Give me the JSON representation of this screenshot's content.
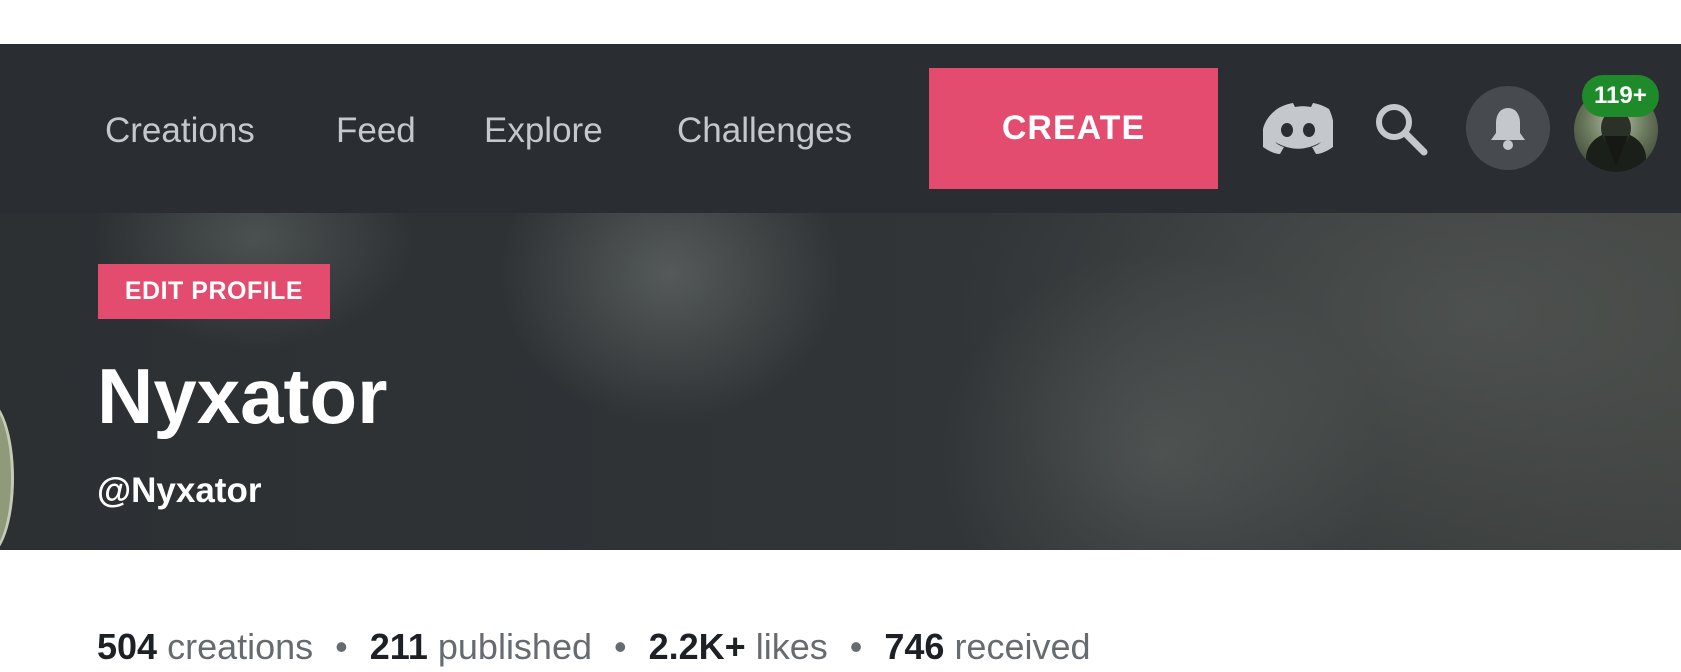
{
  "nav": {
    "items": [
      {
        "label": "Creations"
      },
      {
        "label": "Feed"
      },
      {
        "label": "Explore"
      },
      {
        "label": "Challenges"
      }
    ],
    "create_label": "CREATE",
    "notification_badge": "119+",
    "icons": [
      "discord-icon",
      "search-icon",
      "bell-icon",
      "avatar"
    ]
  },
  "profile": {
    "edit_label": "EDIT PROFILE",
    "name": "Nyxator",
    "handle": "@Nyxator"
  },
  "stats": [
    {
      "value": "504",
      "label": "creations"
    },
    {
      "value": "211",
      "label": "published"
    },
    {
      "value": "2.2K+",
      "label": "likes"
    },
    {
      "value": "746",
      "label": "received"
    }
  ],
  "colors": {
    "accent": "#e34c6e",
    "topbar": "#2a2e33",
    "badge": "#1e8a2a"
  }
}
